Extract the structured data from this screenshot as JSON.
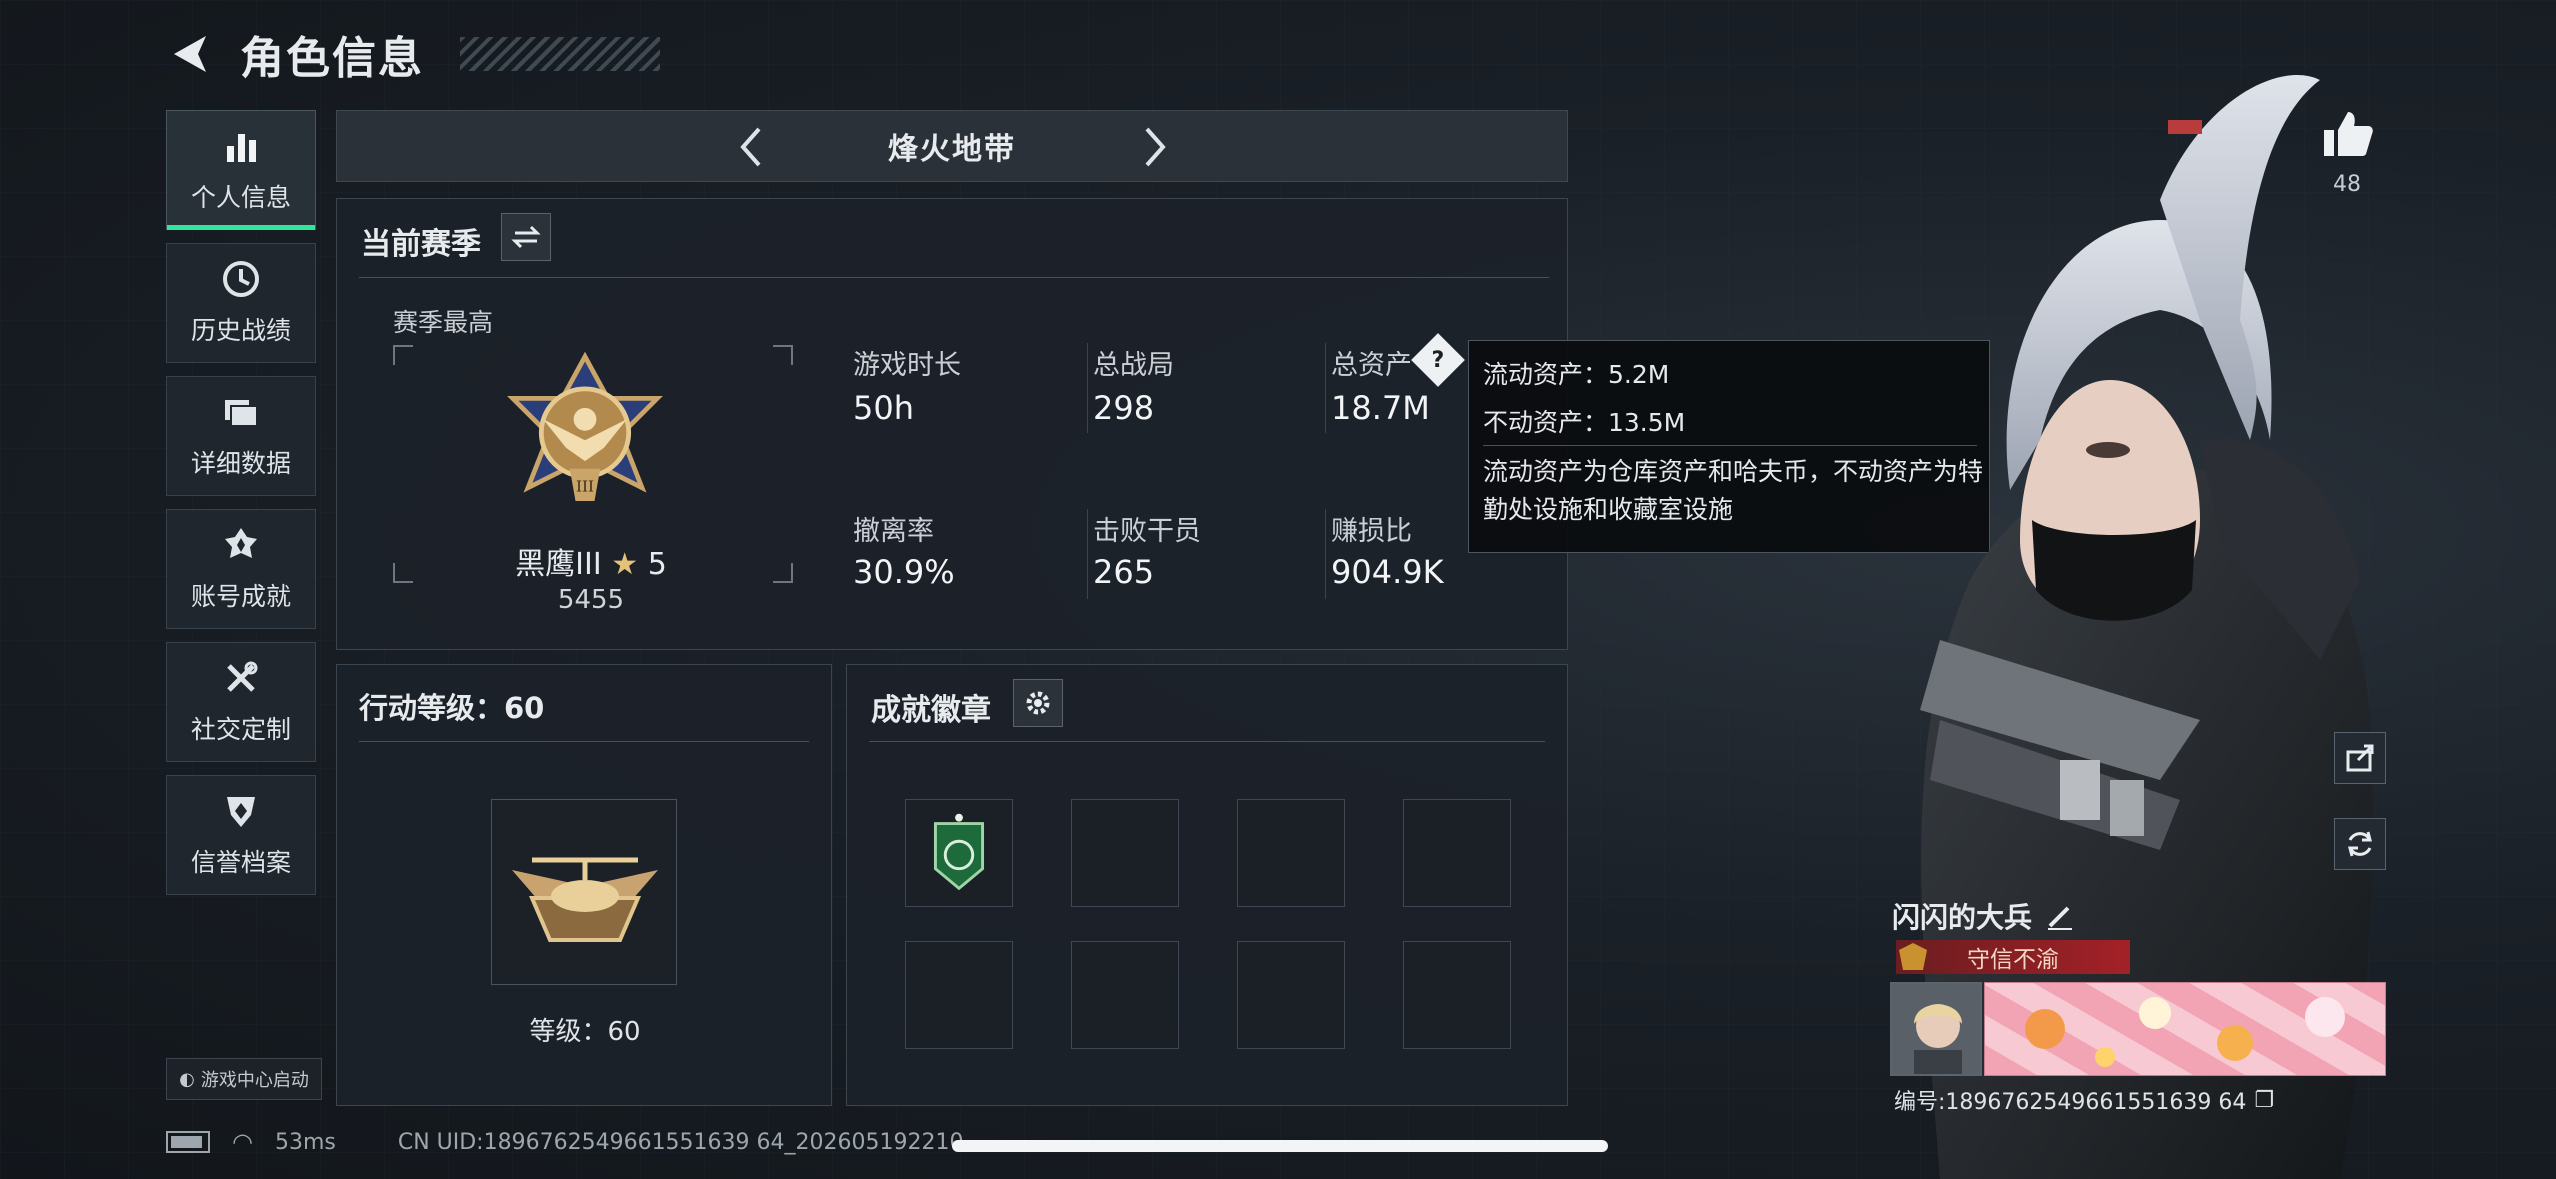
{
  "header": {
    "title": "角色信息"
  },
  "sidebar": {
    "items": [
      {
        "label": "个人信息",
        "icon": "bar-chart-icon",
        "active": true
      },
      {
        "label": "历史战绩",
        "icon": "clock-icon"
      },
      {
        "label": "详细数据",
        "icon": "folder-icon"
      },
      {
        "label": "账号成就",
        "icon": "achievement-icon"
      },
      {
        "label": "社交定制",
        "icon": "tools-icon"
      },
      {
        "label": "信誉档案",
        "icon": "shield-icon"
      }
    ],
    "launch_badge": "游戏中心启动"
  },
  "mode": {
    "title": "烽火地带"
  },
  "season": {
    "title": "当前赛季",
    "best_label": "赛季最高",
    "rank_name": "黑鹰III",
    "rank_stars": "5",
    "rank_score": "5455",
    "stats": [
      {
        "label": "游戏时长",
        "value": "50h"
      },
      {
        "label": "总战局",
        "value": "298"
      },
      {
        "label": "总资产",
        "value": "18.7M"
      },
      {
        "label": "撤离率",
        "value": "30.9%"
      },
      {
        "label": "击败干员",
        "value": "265"
      },
      {
        "label": "赚损比",
        "value": "904.9K"
      }
    ]
  },
  "tooltip": {
    "liquid": "流动资产：5.2M",
    "fixed": "不动资产：13.5M",
    "desc": "流动资产为仓库资产和哈夫币，不动资产为特勤处设施和收藏室设施"
  },
  "action_level": {
    "title": "行动等级：60",
    "level_label": "等级：60"
  },
  "badges": {
    "title": "成就徽章"
  },
  "profile": {
    "likes": "48",
    "player_name": "闪闪的大兵",
    "player_title": "守信不渝",
    "uid_line": "编号:1896762549661551639 64"
  },
  "status": {
    "ping": "53ms",
    "uid": "CN UID:1896762549661551639 64_202605192210"
  },
  "colors": {
    "accent": "#30e69c",
    "title_bar": "#a32127",
    "background": "#161b21"
  }
}
